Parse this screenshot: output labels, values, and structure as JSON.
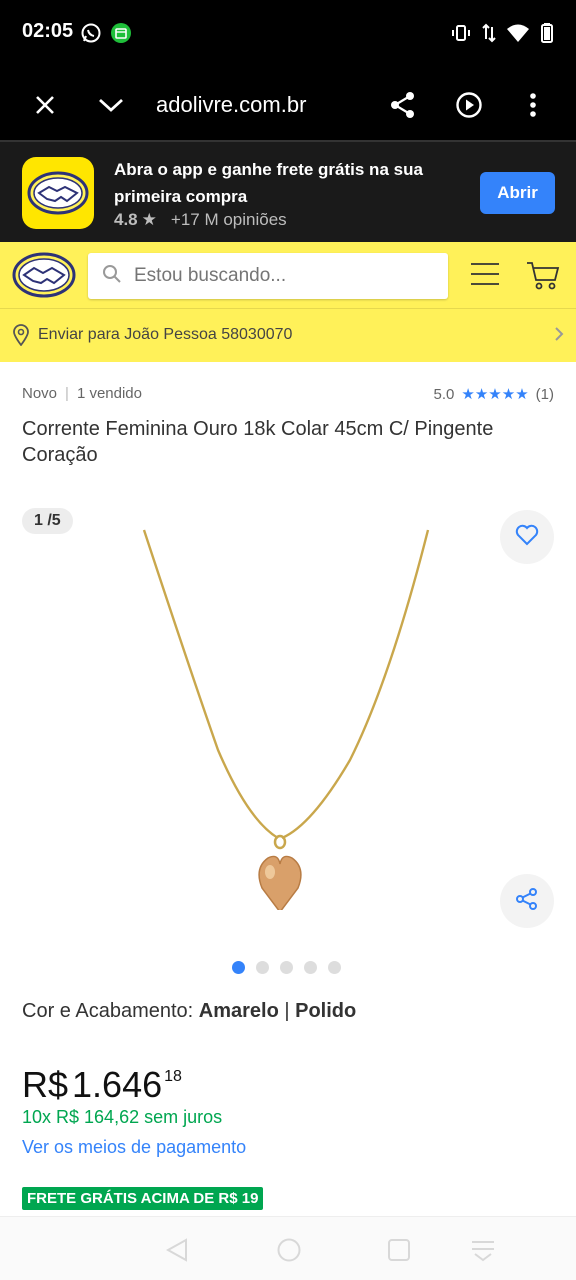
{
  "status_bar": {
    "time": "02:05",
    "icons": [
      "whatsapp-icon",
      "notification-app-icon",
      "vibrate-icon",
      "data-icon",
      "wifi-icon",
      "battery-icon"
    ]
  },
  "browser": {
    "url": "adolivre.com.br",
    "icons": [
      "close-icon",
      "chevron-down-icon",
      "share-icon",
      "play-icon",
      "more-vert-icon"
    ]
  },
  "app_banner": {
    "title": "Abra o app e ganhe frete grátis na sua primeira compra",
    "rating": "4.8",
    "reviews": "+17 M opiniões",
    "open_label": "Abrir"
  },
  "header": {
    "search_placeholder": "Estou buscando..."
  },
  "shipping": {
    "text": "Enviar para João Pessoa 58030070"
  },
  "product": {
    "condition": "Novo",
    "sold": "1 vendido",
    "rating_value": "5.0",
    "rating_stars": 5,
    "rating_count": "(1)",
    "title": "Corrente Feminina Ouro 18k Colar 45cm C/ Pingente Coração",
    "image_counter": "1 /5",
    "image_total": 5,
    "image_index": 1,
    "variant_label": "Cor e Acabamento: ",
    "variant_color": "Amarelo",
    "variant_sep": " | ",
    "variant_finish": "Polido",
    "price_currency": "R$",
    "price_amount": "1.646",
    "price_cents": "18",
    "installments": "10x R$ 164,62 sem juros",
    "payment_link": "Ver os meios de pagamento",
    "free_shipping_tag": "FRETE GRÁTIS ACIMA DE R$ 19"
  },
  "colors": {
    "ml_yellow": "#fff159",
    "ml_blue": "#3483fa",
    "ml_green": "#00a650"
  }
}
